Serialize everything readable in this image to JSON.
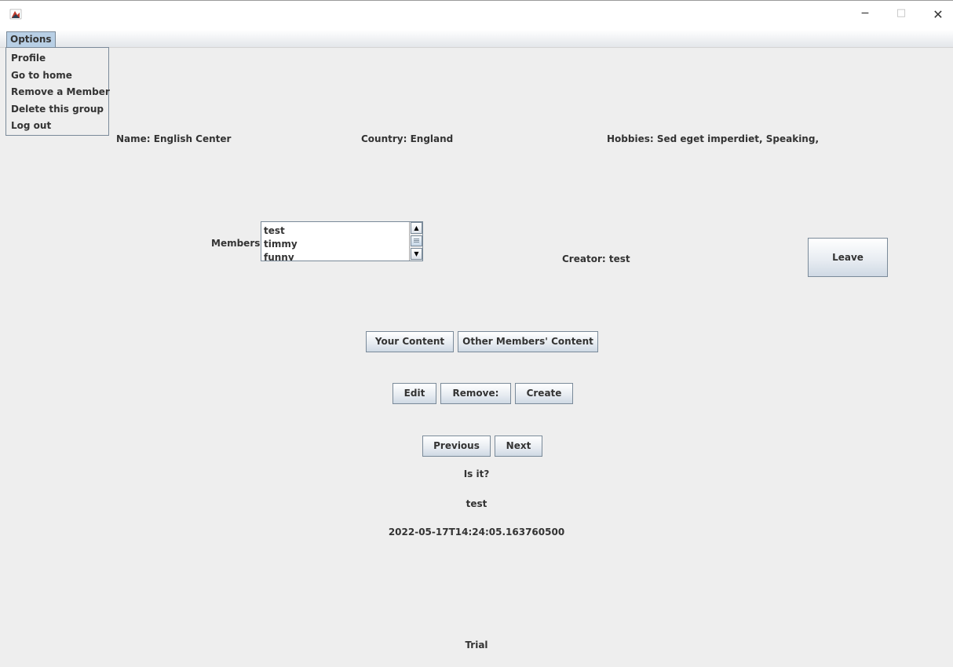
{
  "window": {
    "controls": {
      "minimize": "−",
      "maximize": "□",
      "close": "✕"
    }
  },
  "menubar": {
    "options_label": "Options",
    "items": [
      "Profile",
      "Go to home",
      "Remove a Member",
      "Delete this group",
      "Log out"
    ]
  },
  "group": {
    "name": "Name: English Center",
    "country": "Country: England",
    "hobbies": "Hobbies: Sed eget imperdiet, Speaking,",
    "members_label": "Members:",
    "members": [
      "test",
      "timmy",
      "funny"
    ],
    "creator": "Creator: test"
  },
  "buttons": {
    "leave": "Leave",
    "your_content": "Your Content",
    "other_content": "Other Members' Content",
    "edit": "Edit",
    "remove": "Remove:",
    "create": "Create",
    "previous": "Previous",
    "next": "Next"
  },
  "content": {
    "title": "Is it?",
    "author": "test",
    "timestamp": "2022-05-17T14:24:05.163760500",
    "footer": "Trial"
  },
  "colors": {
    "background": "#eeeeee",
    "menu_highlight": "#b8cfe5",
    "border": "#7a8a99"
  },
  "icons": {
    "app": "java-cup-icon",
    "scroll_up": "arrow-up-icon",
    "scroll_down": "arrow-down-icon"
  }
}
